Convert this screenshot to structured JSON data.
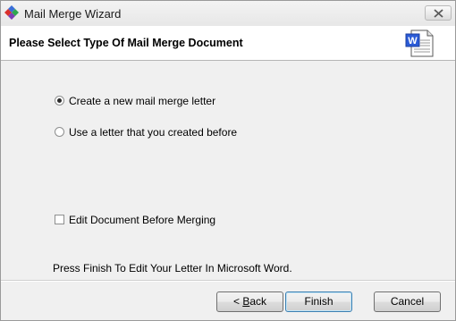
{
  "window": {
    "title": "Mail Merge Wizard",
    "app_icon": "mail-merge-app-icon",
    "close_icon": "close-icon"
  },
  "header": {
    "title": "Please Select Type Of Mail Merge Document",
    "icon": "word-document-icon"
  },
  "options": {
    "create_new": {
      "label": "Create a new mail merge letter",
      "selected": true
    },
    "use_existing": {
      "label": "Use a letter that you created before",
      "selected": false
    }
  },
  "edit_before_merge": {
    "label": "Edit Document Before Merging",
    "checked": false
  },
  "hint": "Press Finish To Edit Your Letter In Microsoft Word.",
  "buttons": {
    "back_prefix": "< ",
    "back_mnemonic": "B",
    "back_suffix": "ack",
    "finish": "Finish",
    "cancel": "Cancel"
  }
}
